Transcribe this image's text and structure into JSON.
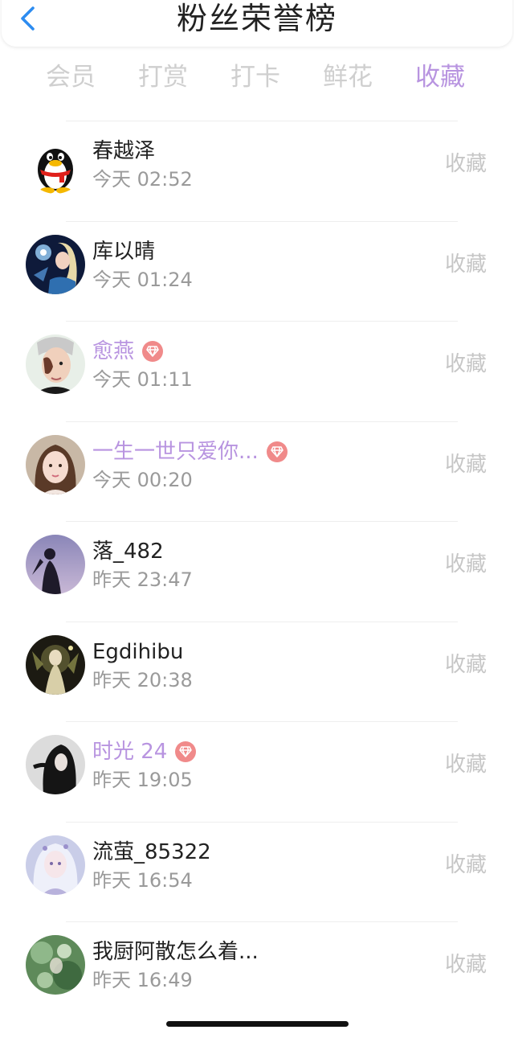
{
  "header": {
    "title": "粉丝荣誉榜",
    "back_icon": "chevron-left-icon",
    "accent_color": "#2d8cf0"
  },
  "tabs": [
    {
      "label": "会员",
      "active": false
    },
    {
      "label": "打赏",
      "active": false
    },
    {
      "label": "打卡",
      "active": false
    },
    {
      "label": "鲜花",
      "active": false
    },
    {
      "label": "收藏",
      "active": true
    }
  ],
  "colors": {
    "active_tab": "#b894e0",
    "vip_name": "#b894e0",
    "vip_badge": "#f08a8a",
    "inactive_tab": "#cfcfcf"
  },
  "fans": [
    {
      "name": "春越泽",
      "time": "今天 02:52",
      "action": "收藏",
      "vip": false,
      "avatar": "qq-penguin-avatar"
    },
    {
      "name": "库以晴",
      "time": "今天 01:24",
      "action": "收藏",
      "vip": false,
      "avatar": "game-character-avatar"
    },
    {
      "name": "愈燕",
      "time": "今天 01:11",
      "action": "收藏",
      "vip": true,
      "avatar": "man-portrait-avatar"
    },
    {
      "name": "一生一世只爱你...",
      "time": "今天 00:20",
      "action": "收藏",
      "vip": true,
      "avatar": "woman-portrait-avatar"
    },
    {
      "name": "落_482",
      "time": "昨天 23:47",
      "action": "收藏",
      "vip": false,
      "avatar": "silhouette-avatar"
    },
    {
      "name": "Egdihibu",
      "time": "昨天 20:38",
      "action": "收藏",
      "vip": false,
      "avatar": "fantasy-art-avatar"
    },
    {
      "name": "时光 24",
      "time": "昨天 19:05",
      "action": "收藏",
      "vip": true,
      "avatar": "hooded-figure-avatar"
    },
    {
      "name": "流萤_85322",
      "time": "昨天 16:54",
      "action": "收藏",
      "vip": false,
      "avatar": "anime-girl-avatar"
    },
    {
      "name": "我厨阿散怎么着...",
      "time": "昨天 16:49",
      "action": "收藏",
      "vip": false,
      "avatar": "green-art-avatar"
    }
  ]
}
